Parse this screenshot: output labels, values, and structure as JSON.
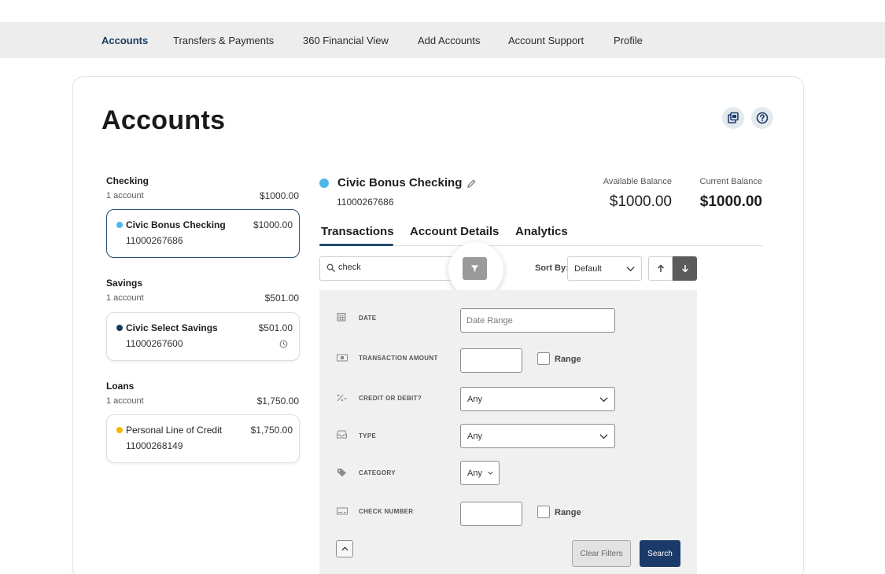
{
  "nav": {
    "items": [
      {
        "label": "Accounts",
        "active": true
      },
      {
        "label": "Transfers & Payments"
      },
      {
        "label": "360 Financial View"
      },
      {
        "label": "Add Accounts"
      },
      {
        "label": "Account Support"
      },
      {
        "label": "Profile"
      }
    ]
  },
  "page": {
    "title": "Accounts",
    "icons": [
      "print-icon",
      "help-icon"
    ]
  },
  "sidebar": {
    "groups": [
      {
        "title": "Checking",
        "count": "1 account",
        "total": "$1000.00",
        "accounts": [
          {
            "name": "Civic Bonus Checking",
            "number": "11000267686",
            "balance": "$1000.00",
            "dot_color": "#4db8e8",
            "selected": true
          }
        ]
      },
      {
        "title": "Savings",
        "count": "1 account",
        "total": "$501.00",
        "accounts": [
          {
            "name": "Civic Select Savings",
            "number": "11000267600",
            "balance": "$501.00",
            "dot_color": "#163c5e",
            "icon": "clock-icon"
          }
        ]
      },
      {
        "title": "Loans",
        "count": "1 account",
        "total": "$1,750.00",
        "accounts": [
          {
            "name": "Personal Line of Credit",
            "number": "11000268149",
            "balance": "$1,750.00",
            "dot_color": "#f5b800"
          }
        ]
      }
    ]
  },
  "account": {
    "name": "Civic Bonus Checking",
    "number": "11000267686",
    "dot_color": "#4db8e8",
    "available_label": "Available Balance",
    "available_value": "$1000.00",
    "current_label": "Current Balance",
    "current_value": "$1000.00"
  },
  "tabs": [
    {
      "label": "Transactions",
      "active": true
    },
    {
      "label": "Account Details"
    },
    {
      "label": "Analytics"
    }
  ],
  "toolbar": {
    "search_value": "check",
    "sort_label": "Sort By:",
    "sort_value": "Default"
  },
  "filters": {
    "date_label": "Date",
    "date_placeholder": "Date Range",
    "amount_label": "Transaction Amount",
    "amount_range_label": "Range",
    "credit_debit_label": "Credit or Debit?",
    "credit_debit_value": "Any",
    "type_label": "Type",
    "type_value": "Any",
    "category_label": "Category",
    "category_value": "Any",
    "check_number_label": "Check Number",
    "check_range_label": "Range",
    "clear_label": "Clear Filters",
    "search_label": "Search"
  },
  "colors": {
    "brand_navy": "#1c3a69",
    "active_nav": "#163c5e",
    "checking_dot": "#4db8e8",
    "savings_dot": "#163c5e",
    "loan_dot": "#f5b800"
  }
}
